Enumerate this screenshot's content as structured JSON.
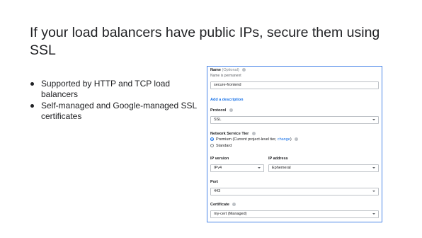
{
  "slide": {
    "title": "If your load balancers have public IPs, secure them using SSL",
    "bullets": [
      "Supported by HTTP and TCP load balancers",
      "Self-managed and Google-managed SSL certificates"
    ]
  },
  "form": {
    "name_label": "Name",
    "name_optional": "(Optional)",
    "name_hint": "Name is permanent",
    "name_value": "secure-frontend",
    "add_description": "Add a description",
    "protocol_label": "Protocol",
    "protocol_value": "SSL",
    "tier_label": "Network Service Tier",
    "tier_premium_text": "Premium (Current project-level tier, ",
    "tier_change_link": "change",
    "tier_premium_close": ")",
    "tier_standard": "Standard",
    "ip_version_label": "IP version",
    "ip_version_value": "IPv4",
    "ip_address_label": "IP address",
    "ip_address_value": "Ephemeral",
    "port_label": "Port",
    "port_value": "443",
    "certificate_label": "Certificate",
    "certificate_value": "my-cert (Managed)"
  },
  "icons": [
    "help-icon",
    "dropdown-caret-icon",
    "radio-selected-icon",
    "radio-unselected-icon"
  ],
  "colors": {
    "accent": "#1a73e8",
    "border": "#4a86e8"
  }
}
